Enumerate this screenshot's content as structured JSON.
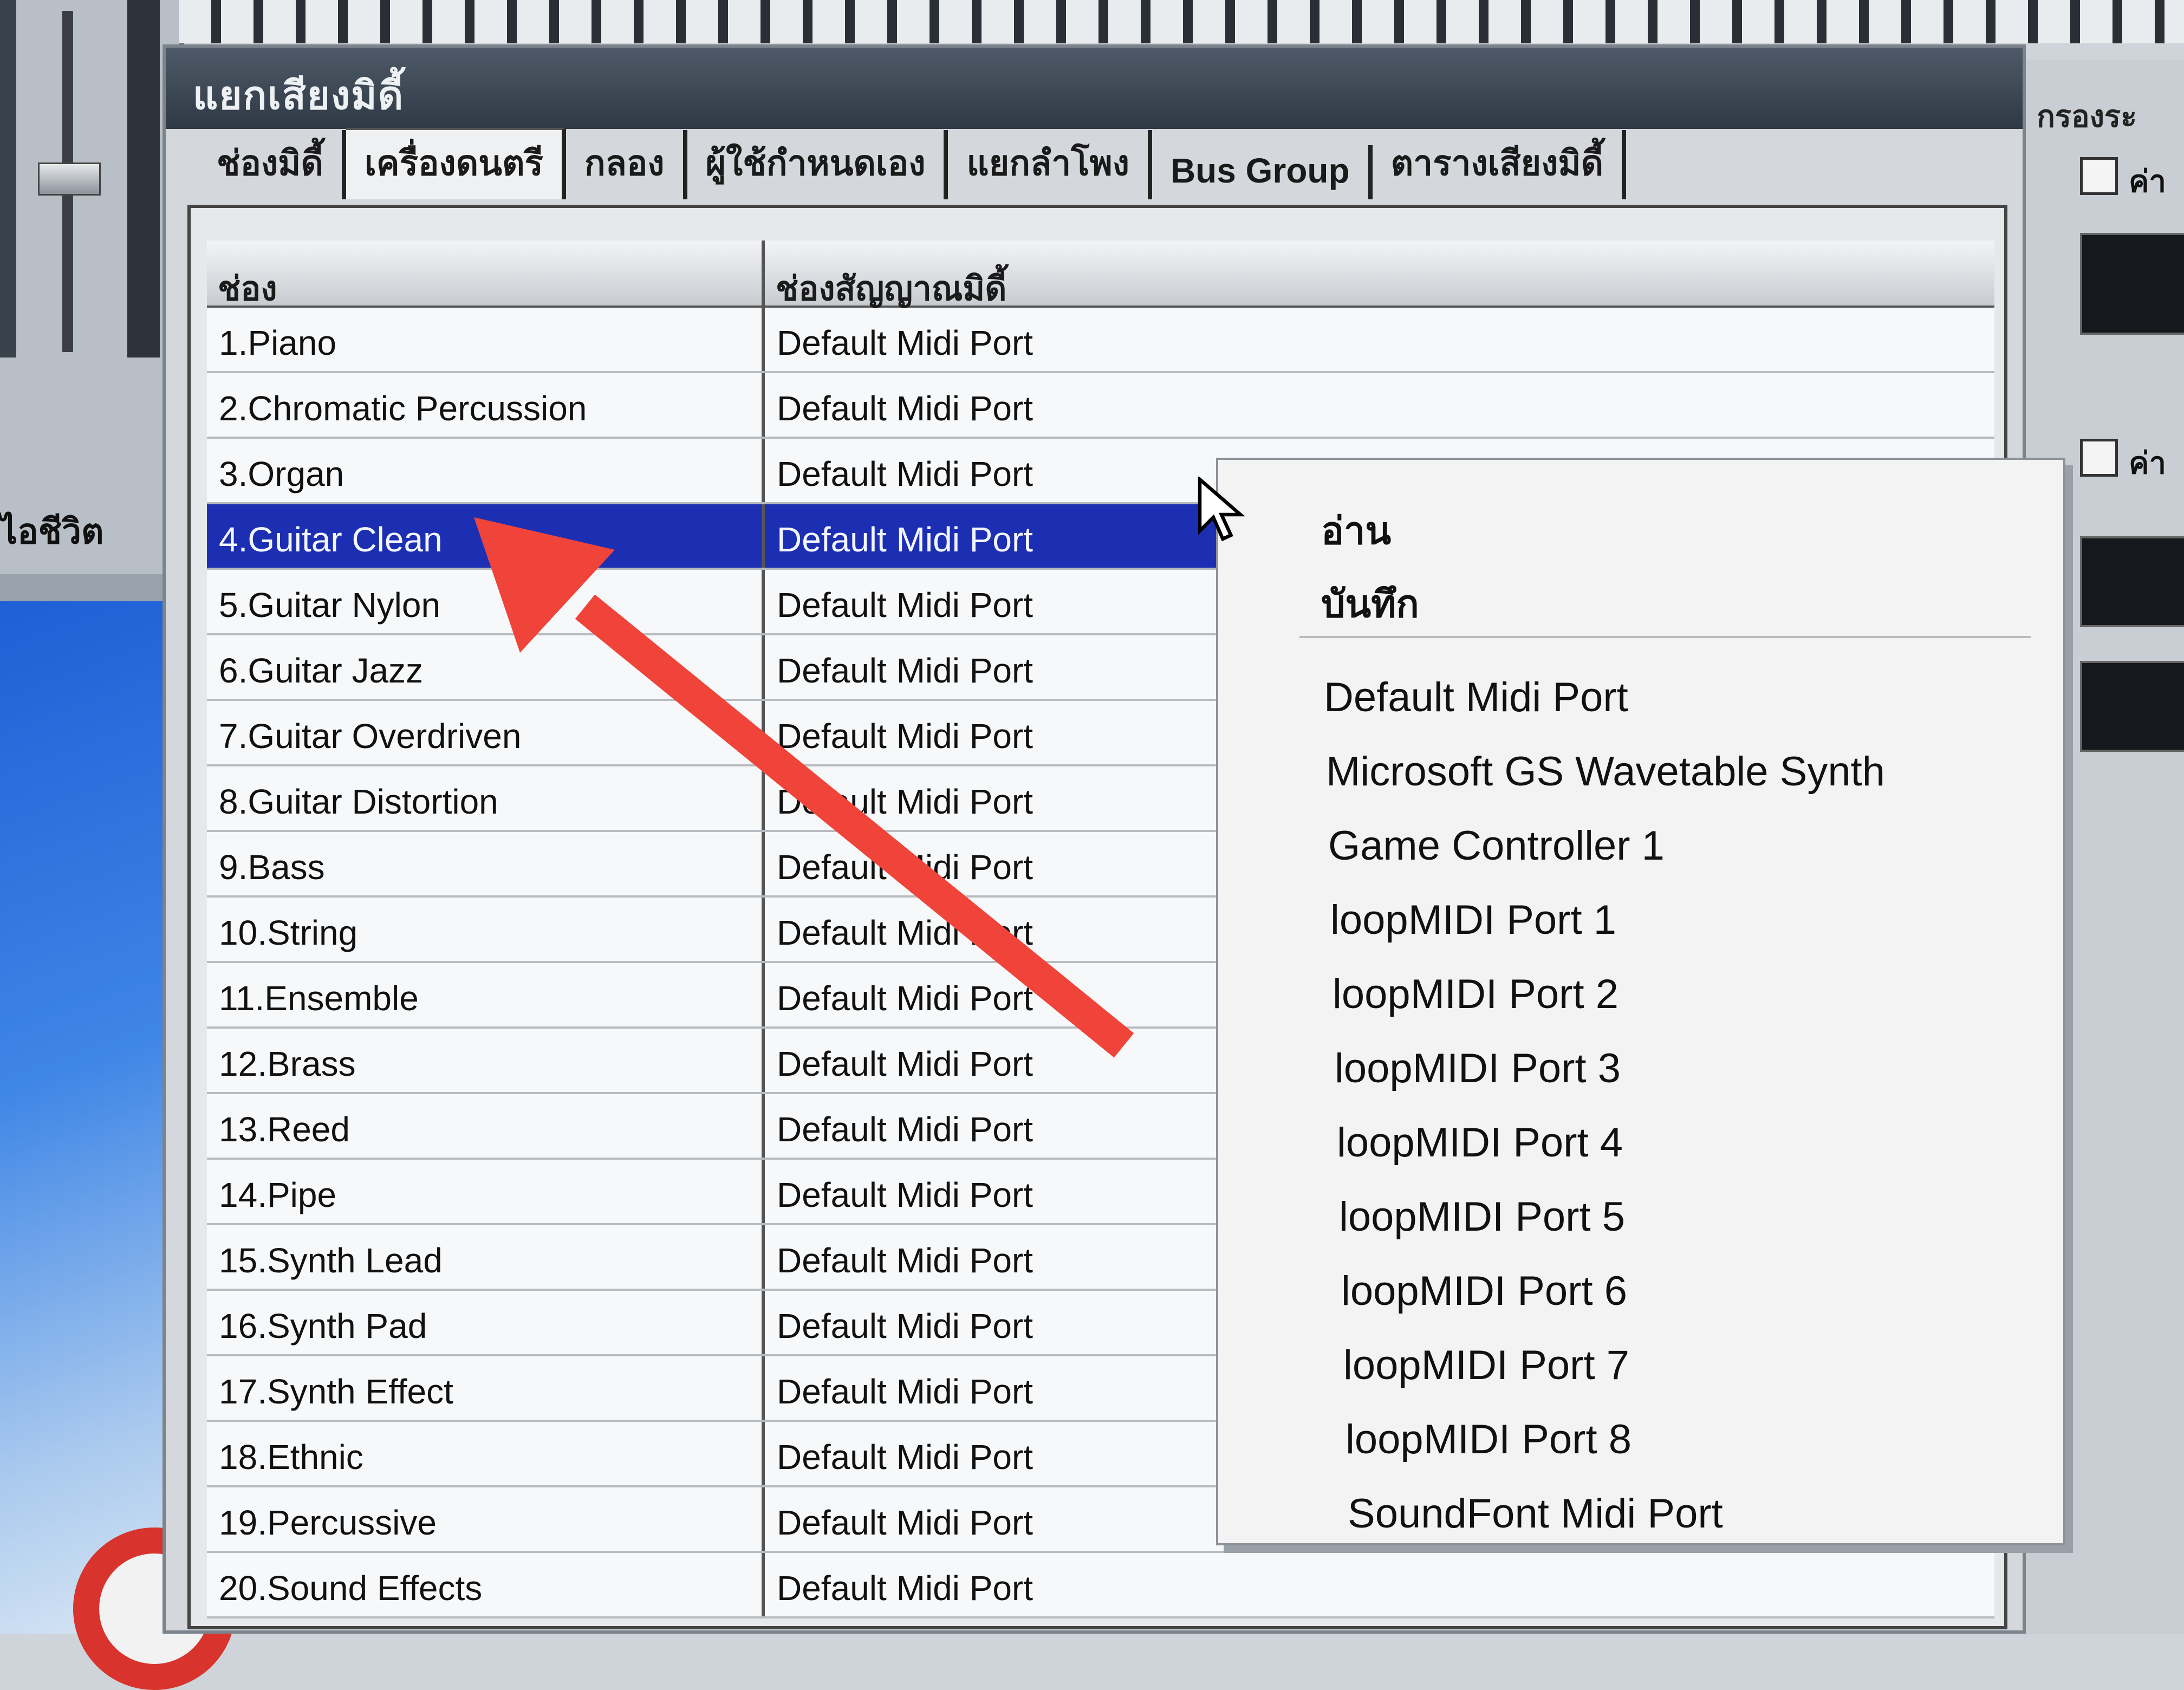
{
  "background": {
    "left_label": "ไอชีวิต"
  },
  "dialog": {
    "title": "แยกเสียงมิดี้",
    "tabs": [
      {
        "label": "ช่องมิดี้"
      },
      {
        "label": "เครื่องดนตรี"
      },
      {
        "label": "กลอง"
      },
      {
        "label": "ผู้ใช้กำหนดเอง"
      },
      {
        "label": "แยกลำโพง"
      },
      {
        "label": "Bus Group"
      },
      {
        "label": "ตารางเสียงมิดี้"
      }
    ],
    "active_tab_index": 1
  },
  "table": {
    "headers": {
      "channel": "ช่อง",
      "port": "ช่องสัญญาณมิดี้"
    },
    "selected_row_index": 3,
    "rows": [
      {
        "channel": "1.Piano",
        "port": "Default Midi Port"
      },
      {
        "channel": "2.Chromatic Percussion",
        "port": "Default Midi Port"
      },
      {
        "channel": "3.Organ",
        "port": "Default Midi Port"
      },
      {
        "channel": "4.Guitar Clean",
        "port": "Default Midi Port"
      },
      {
        "channel": "5.Guitar Nylon",
        "port": "Default Midi Port"
      },
      {
        "channel": "6.Guitar Jazz",
        "port": "Default Midi Port"
      },
      {
        "channel": "7.Guitar Overdriven",
        "port": "Default Midi Port"
      },
      {
        "channel": "8.Guitar Distortion",
        "port": "Default Midi Port"
      },
      {
        "channel": "9.Bass",
        "port": "Default Midi Port"
      },
      {
        "channel": "10.String",
        "port": "Default Midi Port"
      },
      {
        "channel": "11.Ensemble",
        "port": "Default Midi Port"
      },
      {
        "channel": "12.Brass",
        "port": "Default Midi Port"
      },
      {
        "channel": "13.Reed",
        "port": "Default Midi Port"
      },
      {
        "channel": "14.Pipe",
        "port": "Default Midi Port"
      },
      {
        "channel": "15.Synth Lead",
        "port": "Default Midi Port"
      },
      {
        "channel": "16.Synth Pad",
        "port": "Default Midi Port"
      },
      {
        "channel": "17.Synth Effect",
        "port": "Default Midi Port"
      },
      {
        "channel": "18.Ethnic",
        "port": "Default Midi Port"
      },
      {
        "channel": "19.Percussive",
        "port": "Default Midi Port"
      },
      {
        "channel": "20.Sound Effects",
        "port": "Default Midi Port"
      }
    ]
  },
  "context_menu": {
    "actions": [
      {
        "label": "อ่าน"
      },
      {
        "label": "บันทึก"
      }
    ],
    "ports": [
      {
        "label": "Default Midi Port"
      },
      {
        "label": "Microsoft GS Wavetable Synth"
      },
      {
        "label": "Game Controller 1"
      },
      {
        "label": "loopMIDI Port 1"
      },
      {
        "label": "loopMIDI Port 2"
      },
      {
        "label": "loopMIDI Port 3"
      },
      {
        "label": "loopMIDI Port 4"
      },
      {
        "label": "loopMIDI Port 5"
      },
      {
        "label": "loopMIDI Port 6"
      },
      {
        "label": "loopMIDI Port 7"
      },
      {
        "label": "loopMIDI Port 8"
      },
      {
        "label": "SoundFont Midi Port"
      }
    ]
  },
  "right_panel": {
    "title": "กรองระ",
    "checkbox_label": "ค่า"
  },
  "colors": {
    "selection": "#1c2fb3",
    "annotation_arrow": "#f0443a"
  }
}
